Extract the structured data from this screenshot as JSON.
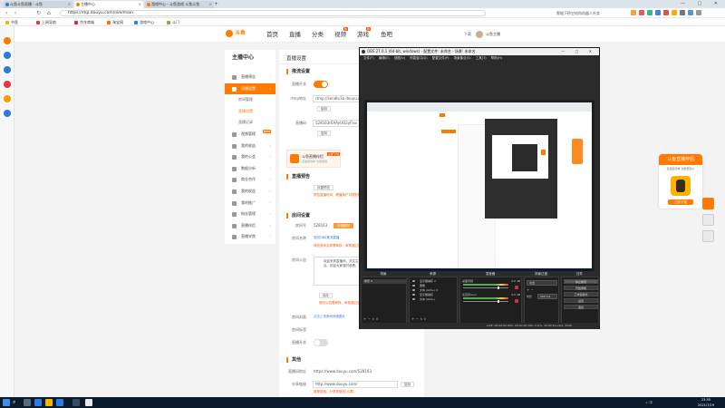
{
  "browser": {
    "tabs": [
      {
        "title": "斗鱼斗鱼直播 - 斗鱼",
        "active": false
      },
      {
        "title": "主播中心",
        "active": true
      },
      {
        "title": "游戏中心 - 斗鱼游戏 斗鱼斗鱼",
        "active": false
      }
    ],
    "new_tab_glyph": "+",
    "window_controls": "— ▢ ✕",
    "url": "https://mp.douyu.com/live/main",
    "search_text": "爬坡下桥它给你机器人外卖",
    "bookmarks": [
      "书签",
      "上网导航",
      "京东商城",
      "淘宝网",
      "游戏中心",
      "斗门"
    ],
    "bookmark_colors": [
      "#f3b400",
      "#e53935",
      "#d32f2f",
      "#ff6d00",
      "#1e88e5",
      "#7cb342"
    ]
  },
  "site": {
    "logo_text": "斗鱼",
    "nav": [
      {
        "label": "首页",
        "highlight": false
      },
      {
        "label": "直播",
        "highlight": false
      },
      {
        "label": "分类",
        "highlight": false
      },
      {
        "label": "视频",
        "highlight": false,
        "badge": "热"
      },
      {
        "label": "游戏",
        "highlight": false,
        "badge": "新"
      },
      {
        "label": "鱼吧",
        "highlight": false
      }
    ],
    "header_right_text": "下载",
    "user_name": "斗鱼主播"
  },
  "sidebar": {
    "title": "主播中心",
    "items": [
      {
        "label": "直播预告",
        "type": "item",
        "active": false
      },
      {
        "label": "直播设置",
        "type": "item",
        "active": true
      },
      {
        "label": "房间管理",
        "type": "sub",
        "on": false
      },
      {
        "label": "直播设置",
        "type": "sub",
        "on": true
      },
      {
        "label": "直播记录",
        "type": "sub",
        "on": false
      },
      {
        "label": "视频管理",
        "type": "item",
        "active": false,
        "badge": "NEW"
      },
      {
        "label": "我的收益",
        "type": "item",
        "active": false
      },
      {
        "label": "我的公会",
        "type": "item",
        "active": false
      },
      {
        "label": "数据分析",
        "type": "item",
        "active": false
      },
      {
        "label": "商业合作",
        "type": "item",
        "active": false
      },
      {
        "label": "我的权益",
        "type": "item",
        "active": false
      },
      {
        "label": "我的推广",
        "type": "item",
        "active": false
      },
      {
        "label": "粉丝管理",
        "type": "item",
        "active": false
      },
      {
        "label": "直播伴侣",
        "type": "item",
        "active": false
      },
      {
        "label": "直播学院",
        "type": "item",
        "active": false
      }
    ]
  },
  "main": {
    "title": "直播设置",
    "stream_section": "推流设置",
    "switch_label": "直播开关",
    "rtmp_label": "rtmp地址",
    "rtmp_value": "rtmp://sendtc3a.douyu.com/live",
    "copy_label": "复制",
    "key_label": "直播码",
    "key_value": "528163rEAAyUQ2yFlxx",
    "promo": {
      "title": "斗鱼直播伴侣",
      "subtitle": "直播更简单 功能更强",
      "cta": "立即下载"
    },
    "preview_section": "直播预告",
    "preview_label": "设置预告",
    "preview_warn": "预告直播时间，看播用户可提前知晓",
    "room_section": "房间设置",
    "room_id_label": "房间号",
    "room_id": "528163",
    "room_badge": "申请靓号",
    "room_name_label": "房间名称",
    "room_name_link": "测试OBS推流直播",
    "room_name_warn": "修改房间名称需审核，审核通过后显示",
    "bulletin_label": "房间公告",
    "bulletin_text": "欢迎来到直播间，关注主播不迷路！公告内容：直播时间每晚八点，欢迎大家准时收看。主播QQ群：5188XXXX",
    "bulletin_btn": "保存",
    "bulletin_warn": "修改公告需审核，审核通过后显示",
    "room_cover_label": "房间封面",
    "room_cover_link": "点击上传房间封面图片",
    "room_type_label": "房间标签",
    "live_toggle_label": "直播开关",
    "other_section": "其他",
    "room_url_label": "直播间地址",
    "room_url": "https://www.douyu.com/528163",
    "share_label": "分享链接",
    "share_url": "http://www.douyu.com/",
    "share_btn": "复制",
    "share_warn": "推荐链接，分享到微信QQ群。"
  },
  "obs": {
    "title": "OBS 27.0.1 (64-bit, windows) - 配置文件: 未命名 - 场景: 未命名",
    "window_controls": "— ▢ ✕",
    "menu": "文件(F) 编辑(E) 视图(V) 停靠窗口(D) 配置文件(P) 场景集合(S) 工具(T) 帮助(H)",
    "docks": [
      "场景",
      "来源",
      "混音器",
      "场景过渡",
      "控件"
    ],
    "scenes": [
      "场景 2"
    ],
    "sources": [
      "显示器捕获 2",
      "图像",
      "文本 (GDI+) 2",
      "显示器捕获",
      "文本 (GDI+)"
    ],
    "mixer": [
      {
        "name": "桌面音频",
        "db": "0.0 dB"
      },
      {
        "name": "麦克风/Aux",
        "db": "0.0 dB"
      }
    ],
    "transition": {
      "name": "淡出",
      "duration_label": "时长",
      "duration": "300 ms"
    },
    "controls": [
      "停止推流",
      "开始录制",
      "工作室模式",
      "设置",
      "退出"
    ],
    "status": "LIVE: 00:00:00    REC: 00:00:00    CPU: 5.6%, 30.00 fps    kb/s: 2548",
    "mini_buttons": "+ − ∧ ∨"
  },
  "float_card": {
    "title": "斗鱼直播伴侣",
    "subtitle": "直播更简单 功能更强大",
    "cta": "立即下载"
  },
  "taskbar": {
    "search_glyph": "⌕",
    "tray_text": "ㅅ 中",
    "time": "23:55",
    "date": "2021/7/19"
  },
  "colors": {
    "accent": "#ff7a00",
    "obs_bg": "#2b2b2b",
    "taskbar": "#0c1a2e"
  }
}
